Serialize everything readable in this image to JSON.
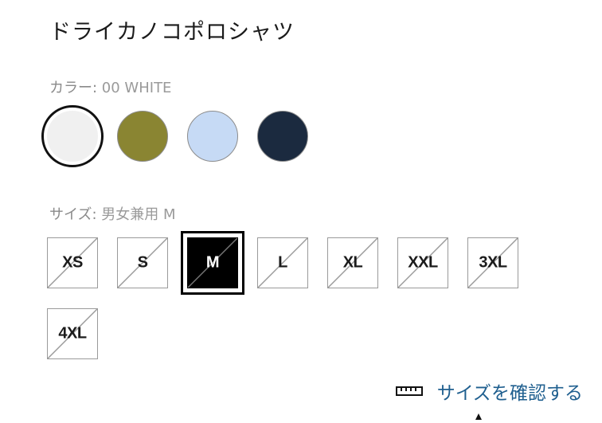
{
  "product": {
    "title": "ドライカノコポロシャツ"
  },
  "color": {
    "label_prefix": "カラー: ",
    "selected_value": "00 WHITE",
    "swatches": [
      {
        "name": "white",
        "hex": "#f0f0f0",
        "selected": true
      },
      {
        "name": "olive",
        "hex": "#8a8532",
        "selected": false
      },
      {
        "name": "light-blue",
        "hex": "#c6daf5",
        "selected": false
      },
      {
        "name": "navy",
        "hex": "#1b2a3f",
        "selected": false
      }
    ]
  },
  "size": {
    "label_prefix": "サイズ: ",
    "selected_value": "男女兼用 M",
    "options": [
      {
        "label": "XS",
        "selected": false,
        "unavailable": true
      },
      {
        "label": "S",
        "selected": false,
        "unavailable": true
      },
      {
        "label": "M",
        "selected": true,
        "unavailable": true
      },
      {
        "label": "L",
        "selected": false,
        "unavailable": true
      },
      {
        "label": "XL",
        "selected": false,
        "unavailable": true
      },
      {
        "label": "XXL",
        "selected": false,
        "unavailable": true
      },
      {
        "label": "3XL",
        "selected": false,
        "unavailable": true
      },
      {
        "label": "4XL",
        "selected": false,
        "unavailable": true
      }
    ]
  },
  "size_guide": {
    "icon": "ruler-icon",
    "label": "サイズを確認する"
  },
  "colors": {
    "link": "#1f5f8f",
    "selected_border": "#111111",
    "unavailable_strike": "#9a9a9a"
  }
}
